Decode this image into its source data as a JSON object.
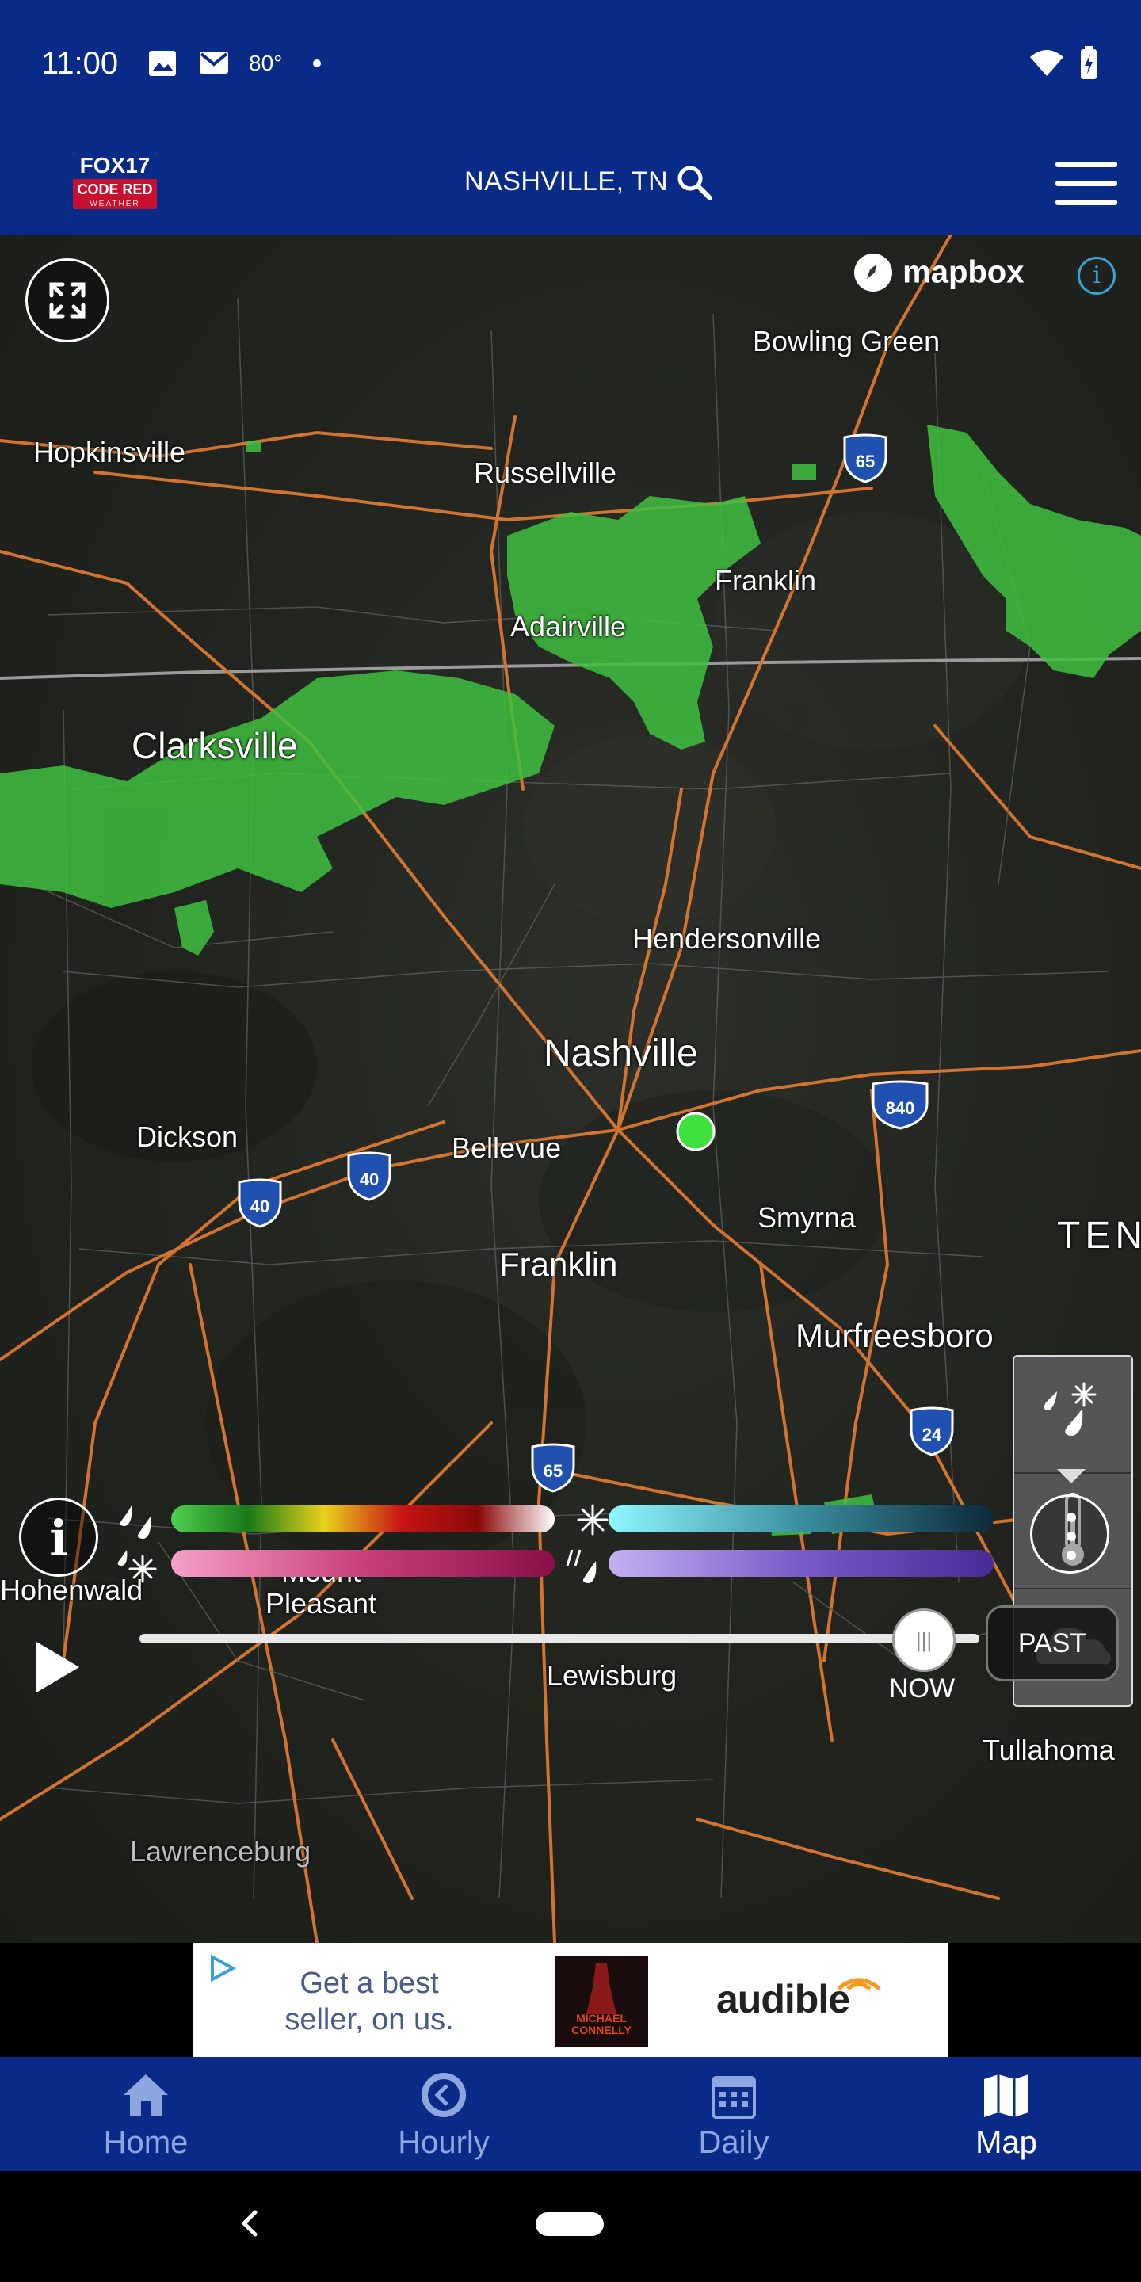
{
  "status_bar": {
    "time": "11:00",
    "temperature": "80°",
    "icons": [
      "image-icon",
      "gmail-icon",
      "notification-dot-icon",
      "wifi-icon",
      "battery-charging-icon"
    ]
  },
  "header": {
    "logo": {
      "line1": "FOX17",
      "line2": "CODE RED",
      "line3": "WEATHER"
    },
    "location": "NASHVILLE, TN",
    "search_icon": "search-icon",
    "menu_icon": "hamburger-menu-icon"
  },
  "map": {
    "attribution": "mapbox",
    "info_glyph": "i",
    "colors": {
      "rain_green": "#3fbf3f",
      "road_orange": "#d2732f",
      "border_gray": "#8a8a8a"
    },
    "cities": {
      "bowling_green": "Bowling Green",
      "hopkinsville": "Hopkinsville",
      "russellville": "Russellville",
      "franklin_ky": "Franklin",
      "adairville": "Adairville",
      "clarksville": "Clarksville",
      "hendersonville": "Hendersonville",
      "nashville": "Nashville",
      "dickson": "Dickson",
      "bellevue": "Bellevue",
      "smyrna": "Smyrna",
      "tennessee": "TEN",
      "franklin_tn": "Franklin",
      "murfreesboro": "Murfreesboro",
      "hohenwald": "Hohenwald",
      "mount_pleasant": "Mount Pleasant",
      "lewisburg": "Lewisburg",
      "tullahoma": "Tullahoma",
      "lawrenceburg": "Lawrenceburg"
    },
    "shields": {
      "i65_north": "65",
      "i840": "840",
      "i40_west": "40",
      "i40_east": "40",
      "i24": "24",
      "i65_south": "65"
    }
  },
  "layers": {
    "items": [
      {
        "name": "precipitation",
        "icon": "rain-snow-icon"
      },
      {
        "name": "temperature",
        "icon": "thermometer-icon"
      },
      {
        "name": "clouds",
        "icon": "cloud-icon"
      }
    ]
  },
  "legend": {
    "info_glyph": "i",
    "rain": {
      "icon": "rain-icon",
      "colors": [
        "#4cd14c",
        "#1a7a1a",
        "#e8d21a",
        "#c81414",
        "#8a0a0a",
        "#ffffff"
      ]
    },
    "snow": {
      "icon": "snow-icon",
      "colors": [
        "#8ff7ff",
        "#3a8fa0",
        "#0d2a3a"
      ]
    },
    "mix": {
      "icon": "snow-mix-icon",
      "colors": [
        "#f59fc8",
        "#c8407a",
        "#8a0f4a"
      ]
    },
    "ice": {
      "icon": "sleet-icon",
      "colors": [
        "#c4b0f2",
        "#7a5ac8",
        "#4a2a96"
      ]
    }
  },
  "timeline": {
    "play_icon": "play-icon",
    "position": 1.0,
    "now_label": "NOW",
    "past_label": "PAST"
  },
  "ad": {
    "text": "Get a best seller, on us.",
    "book_text": "MICHAEL CONNELLY",
    "brand": "audible"
  },
  "bottom_nav": {
    "items": [
      {
        "label": "Home",
        "icon": "home-icon",
        "active": false
      },
      {
        "label": "Hourly",
        "icon": "clock-icon",
        "active": false
      },
      {
        "label": "Daily",
        "icon": "calendar-icon",
        "active": false
      },
      {
        "label": "Map",
        "icon": "map-icon",
        "active": true
      }
    ]
  }
}
